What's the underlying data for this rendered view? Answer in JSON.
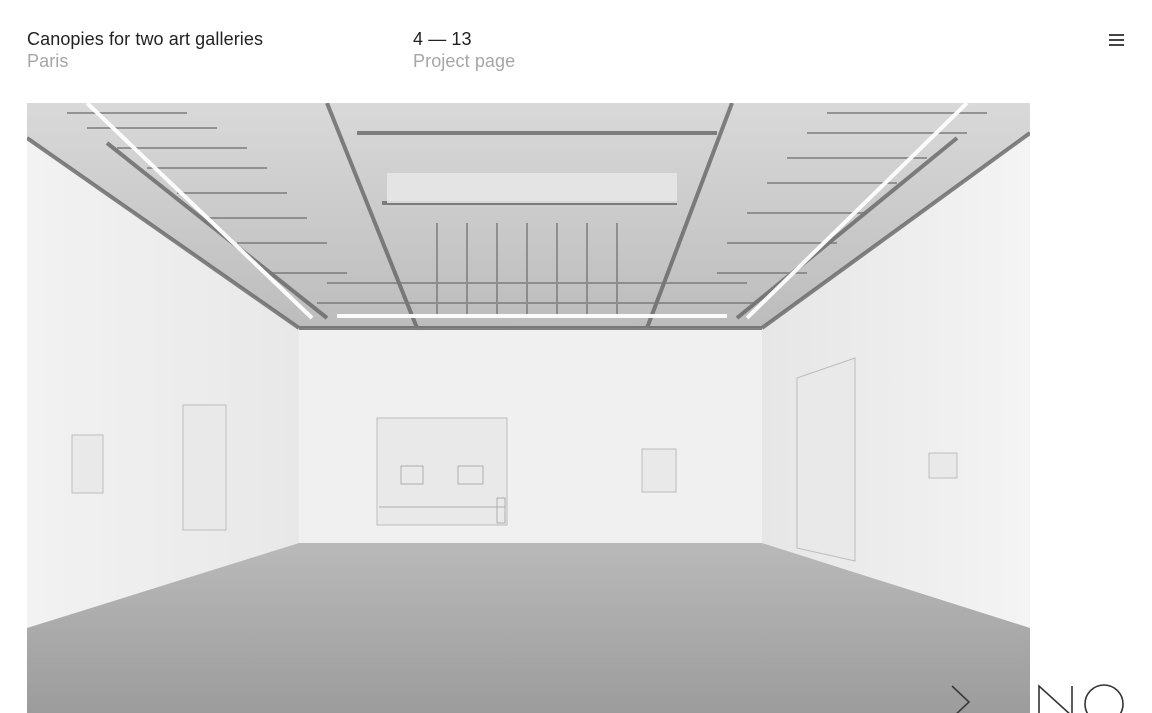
{
  "project": {
    "title": "Canopies for two art galleries",
    "location": "Paris"
  },
  "pager": {
    "counter": "4 — 13",
    "link_label": "Project page"
  },
  "icons": {
    "menu": "hamburger-menu-icon",
    "next": "chevron-right-icon"
  },
  "logo": {
    "text": "NO"
  },
  "colors": {
    "primary_text": "#222222",
    "secondary_text": "#a6a6a6",
    "background": "#ffffff"
  }
}
